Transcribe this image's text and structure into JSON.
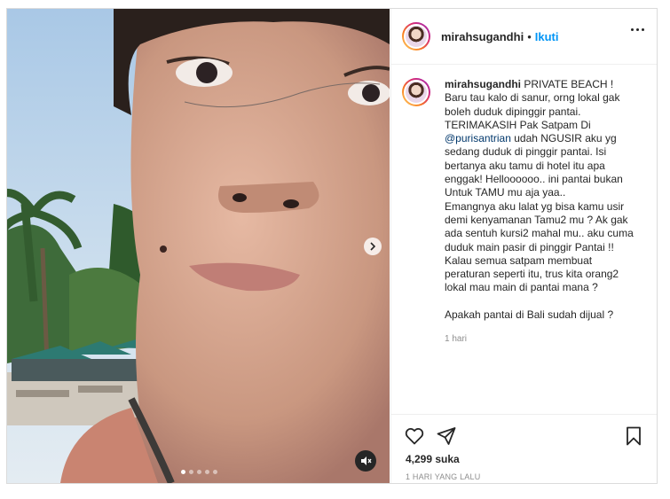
{
  "post": {
    "username": "mirahsugandhi",
    "separator": "•",
    "follow_label": "Ikuti"
  },
  "caption": {
    "username": "mirahsugandhi",
    "text_before": " PRIVATE BEACH !\nBaru tau kalo di sanur, orng lokal gak boleh duduk dipinggir pantai.\nTERIMAKASIH Pak Satpam Di ",
    "mention": "@purisantrian",
    "text_after": " udah NGUSIR aku yg sedang duduk di pinggir pantai. Isi bertanya aku tamu di hotel itu apa enggak! Helloooooo.. ini pantai bukan Untuk TAMU mu aja yaa..\nEmangnya aku lalat yg bisa kamu usir demi kenyamanan Tamu2 mu ? Ak gak ada sentuh kursi2 mahal mu.. aku cuma duduk main pasir di pinggir Pantai !!\nKalau semua satpam membuat peraturan seperti itu, trus kita orang2 lokal mau main di pantai mana ?\n\nApakah pantai di Bali sudah dijual ?",
    "time": "1 hari"
  },
  "stats": {
    "likes": "4,299 suka",
    "date": "1 HARI YANG LALU"
  },
  "carousel": {
    "slide_count": 5,
    "active_index": 0
  },
  "colors": {
    "follow_blue": "#0095f6",
    "mention_blue": "#00376b",
    "text": "#262626",
    "muted": "#8e8e8e",
    "border": "#dbdbdb"
  },
  "icons": {
    "next": "chevron-right-icon",
    "mute": "speaker-muted-icon",
    "like": "heart-icon",
    "share": "paper-plane-icon",
    "save": "bookmark-icon",
    "more": "more-options-icon"
  }
}
